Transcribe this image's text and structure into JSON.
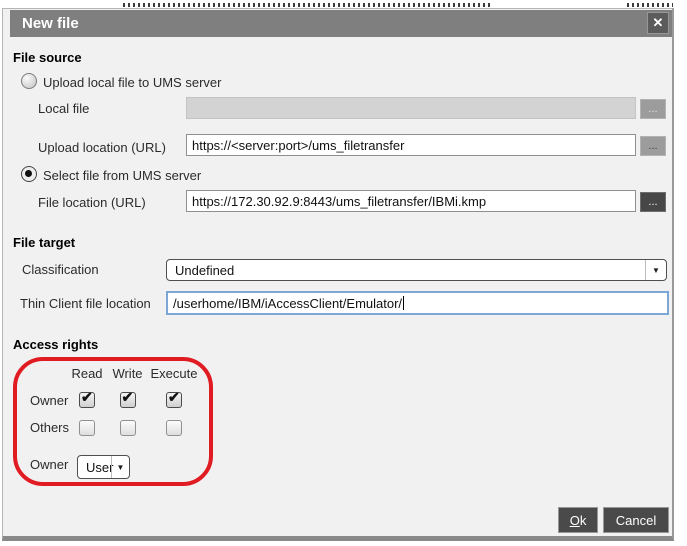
{
  "window": {
    "title": "New file",
    "close_icon": "✕"
  },
  "colors": {
    "title_bar": "#7f7f7f",
    "dialog_bg": "#f1f1f1",
    "annotation_red": "#e01b22",
    "button_dark": "#4a4a4a",
    "focus_border_blue": "#7ba7d7"
  },
  "file_source": {
    "heading": "File source",
    "upload_radio_label": "Upload local file to UMS server",
    "upload_radio_selected": false,
    "local_file": {
      "label": "Local file",
      "value": "",
      "browse_label": "..."
    },
    "upload_location": {
      "label": "Upload location (URL)",
      "value": "https://<server:port>/ums_filetransfer",
      "browse_label": "..."
    },
    "select_radio_label": "Select file from UMS server",
    "select_radio_selected": true,
    "file_location": {
      "label": "File location (URL)",
      "value": "https://172.30.92.9:8443/ums_filetransfer/IBMi.kmp",
      "browse_label": "..."
    }
  },
  "file_target": {
    "heading": "File target",
    "classification": {
      "label": "Classification",
      "value": "Undefined"
    },
    "thin_client_file_location": {
      "label": "Thin Client file location",
      "value": "/userhome/IBM/iAccessClient/Emulator/"
    }
  },
  "access_rights": {
    "heading": "Access rights",
    "columns": [
      "Read",
      "Write",
      "Execute"
    ],
    "rows": [
      {
        "label": "Owner",
        "read": true,
        "write": true,
        "execute": true
      },
      {
        "label": "Others",
        "read": false,
        "write": false,
        "execute": false
      }
    ],
    "owner_select": {
      "label": "Owner",
      "value": "User"
    }
  },
  "footer": {
    "ok_label": "Ok",
    "cancel_label": "Cancel"
  }
}
